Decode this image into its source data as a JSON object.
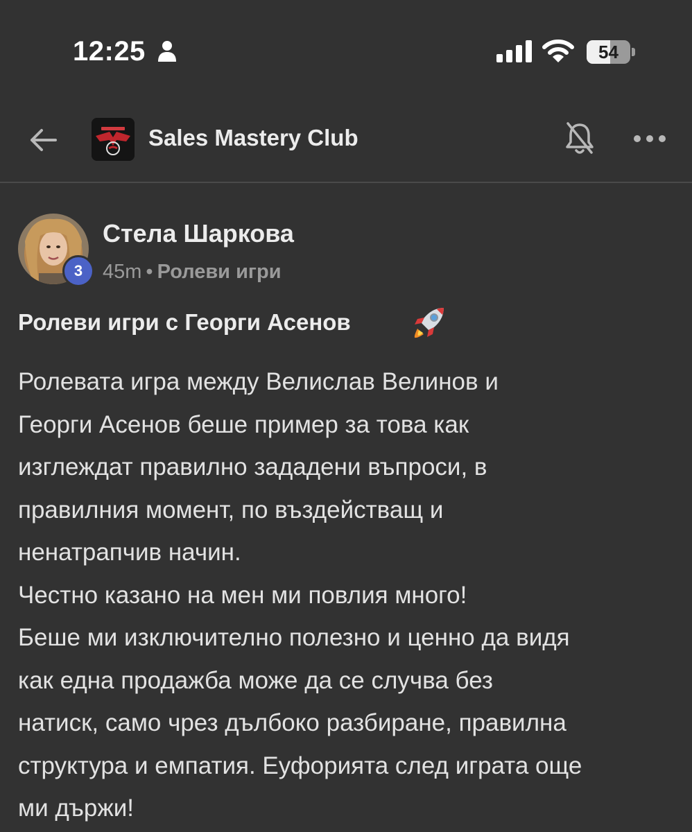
{
  "status_bar": {
    "time": "12:25",
    "battery_level": "54",
    "battery_fraction": 0.54,
    "icons": [
      "person-icon",
      "cellular-signal-icon",
      "wifi-icon",
      "battery-icon"
    ]
  },
  "header": {
    "group_name": "Sales Mastery Club",
    "icons": [
      "back-arrow-icon",
      "group-logo",
      "bell-muted-icon",
      "more-icon"
    ]
  },
  "post": {
    "author": "Стела Шаркова",
    "level": "3",
    "time_ago": "45m",
    "separator": "•",
    "category": "Ролеви игри",
    "title": "Ролеви игри с Георги Асенов",
    "title_emoji": "rocket-icon",
    "body_lines": [
      "Ролевата игра между Велислав Велинов и",
      "Георги Асенов беше пример за това как",
      "изглеждат правилно зададени въпроси, в",
      "правилния момент, по въздействащ и",
      "ненатрапчив начин.",
      "Честно казано на мен ми повлия много!",
      "Беше ми изключително полезно и ценно да видя",
      "как една продажба може да се случва без",
      "натиск, само чрез дълбоко разбиране, правилна",
      "структура и емпатия. Еуфорията след играта още",
      "ми държи!"
    ]
  },
  "colors": {
    "background": "#323232",
    "text_primary": "#ececec",
    "text_secondary": "#9a9a9a",
    "level_badge": "#4b62c6"
  }
}
